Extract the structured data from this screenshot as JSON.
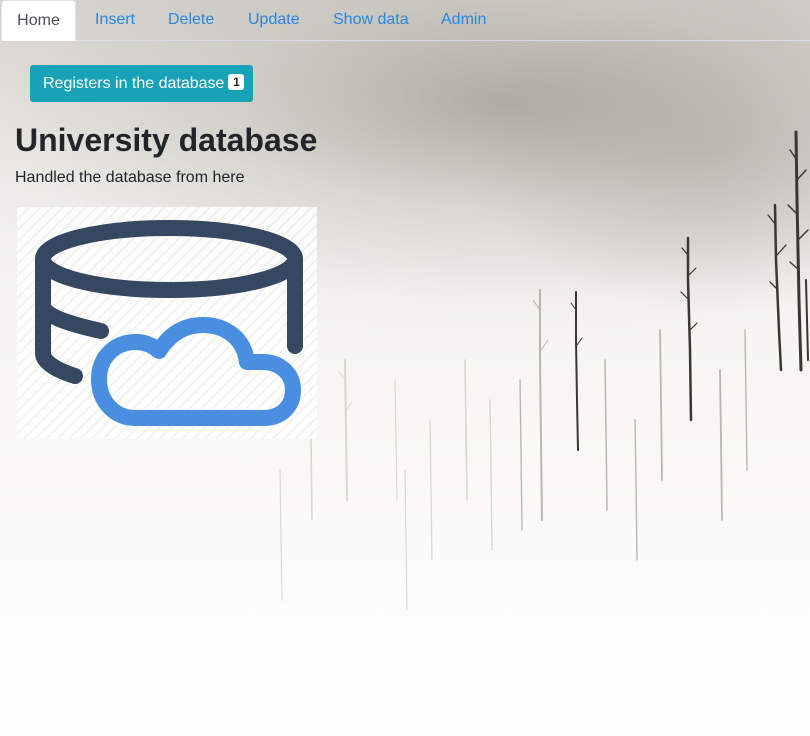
{
  "nav": {
    "tabs": [
      {
        "label": "Home",
        "active": true
      },
      {
        "label": "Insert",
        "active": false
      },
      {
        "label": "Delete",
        "active": false
      },
      {
        "label": "Update",
        "active": false
      },
      {
        "label": "Show data",
        "active": false
      },
      {
        "label": "Admin",
        "active": false
      }
    ]
  },
  "registers_button": {
    "label": "Registers in the database",
    "count": "1"
  },
  "header": {
    "title": "University database",
    "subtitle": "Handled the database from here"
  },
  "illustration": {
    "icon": "database-cloud-icon"
  },
  "colors": {
    "link": "#2a86e0",
    "button": "#17a2b8",
    "database_stroke": "#364761",
    "cloud_stroke": "#4a8fdf"
  }
}
